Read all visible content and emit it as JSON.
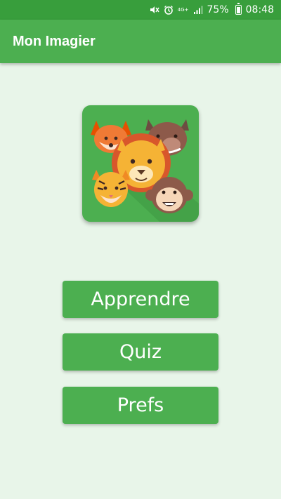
{
  "status_bar": {
    "network": "4G+",
    "battery_percent": "75%",
    "battery_level": 0.75,
    "time": "08:48",
    "icons": [
      "mute-icon",
      "alarm-icon",
      "signal-icon",
      "battery-icon"
    ]
  },
  "app_bar": {
    "title": "Mon Imagier"
  },
  "logo": {
    "icon": "animals-logo-icon"
  },
  "menu": {
    "learn_label": "Apprendre",
    "quiz_label": "Quiz",
    "prefs_label": "Prefs"
  },
  "colors": {
    "status_bar": "#389e3c",
    "primary": "#4caf50",
    "background": "#e8f5e9",
    "text_on_primary": "#ffffff"
  }
}
